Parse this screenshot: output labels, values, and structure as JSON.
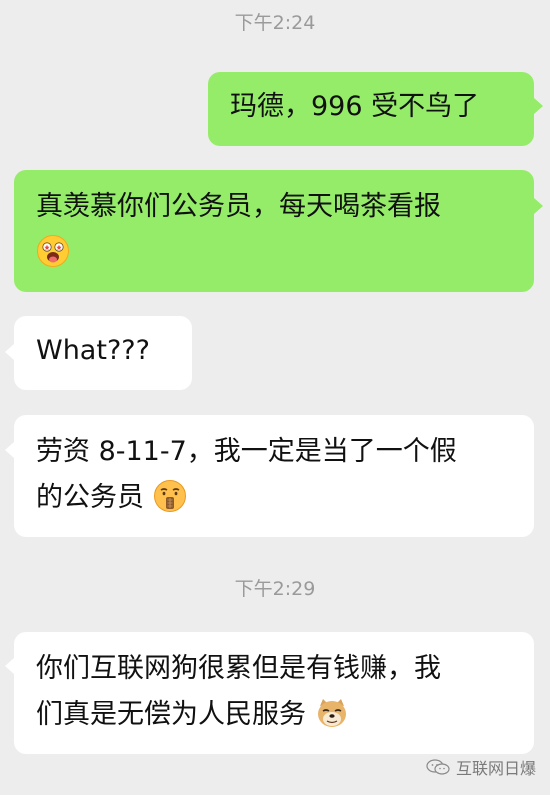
{
  "timestamps": [
    "下午2:24",
    "下午2:29"
  ],
  "messages": [
    {
      "side": "right",
      "text": "玛德，996 受不鸟了"
    },
    {
      "side": "right",
      "text": "真羡慕你们公务员，每天喝茶看报",
      "emoji": "star-eyes-tongue-face-emoji"
    },
    {
      "side": "left",
      "text": "What???"
    },
    {
      "side": "left",
      "line1": "劳资 8-11-7，我一定是当了一个假",
      "line2": "的公务员",
      "emoji": "zipper-mouth-face-emoji"
    },
    {
      "side": "left",
      "line1": "你们互联网狗很累但是有钱赚，我",
      "line2": "们真是无偿为人民服务",
      "emoji": "doge-emoji"
    }
  ],
  "watermark": {
    "text": "互联网日爆",
    "icon": "wechat-logo-icon"
  },
  "colors": {
    "background": "#ededed",
    "green_bubble": "#95ec69",
    "white_bubble": "#ffffff",
    "timestamp": "#9a9a9a"
  }
}
